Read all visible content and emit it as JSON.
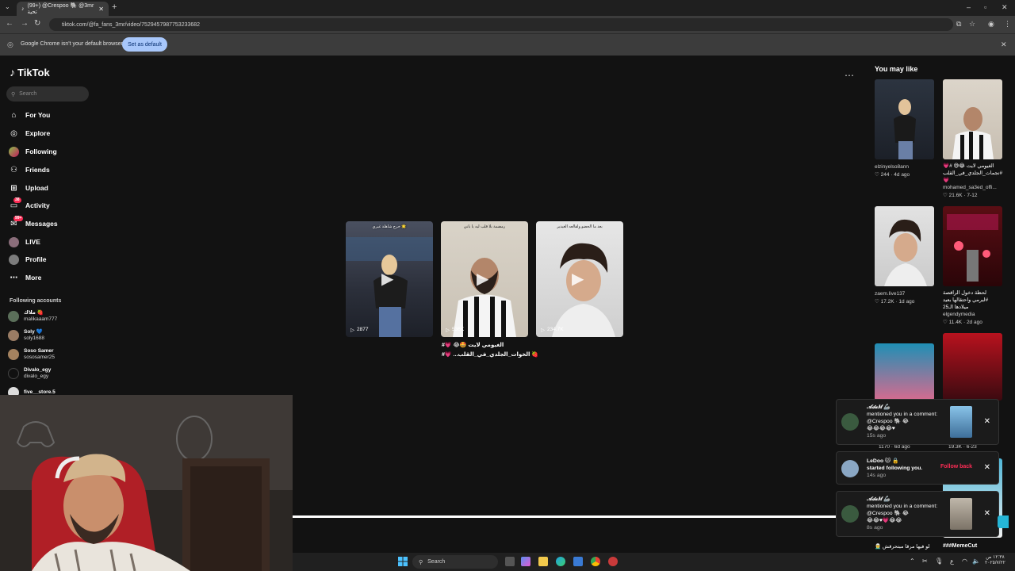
{
  "browser": {
    "tab_title": "(99+) @Crespoo 🐘 @3mr تحية",
    "url": "tiktok.com/@fa_fans_3mr/video/7529457987753233682",
    "infobar_text": "Google Chrome isn't your default browser",
    "set_default_label": "Set as default"
  },
  "sidebar": {
    "logo": "TikTok",
    "search_placeholder": "Search",
    "items": [
      {
        "label": "For You",
        "icon": "home-icon"
      },
      {
        "label": "Explore",
        "icon": "compass-icon"
      },
      {
        "label": "Following",
        "icon": "following-icon"
      },
      {
        "label": "Friends",
        "icon": "friends-icon"
      },
      {
        "label": "Upload",
        "icon": "upload-icon"
      },
      {
        "label": "Activity",
        "icon": "activity-icon",
        "badge": "38"
      },
      {
        "label": "Messages",
        "icon": "messages-icon",
        "badge": "99+"
      },
      {
        "label": "LIVE",
        "icon": "live-icon"
      },
      {
        "label": "Profile",
        "icon": "profile-icon"
      },
      {
        "label": "More",
        "icon": "more-icon"
      }
    ],
    "following_header": "Following accounts",
    "accounts": [
      {
        "name": "ملاك 🍓",
        "handle": "malikaaam777"
      },
      {
        "name": "Soly 💙",
        "handle": "soly1688"
      },
      {
        "name": "Soso Samer",
        "handle": "sososamer25"
      },
      {
        "name": "Divalo_egy",
        "handle": "divalo_egy"
      },
      {
        "name": "five__store.5",
        "handle": ""
      }
    ]
  },
  "videos": [
    {
      "views": "2877",
      "caption_overlay": "خرج شاهلة غيري 🌟"
    },
    {
      "views": "536K",
      "caption_overlay": "رمضمة بلا قلب ليه يا باني",
      "caption": "#💗 😂🤩 الغيومي لايت",
      "caption2": "#💗 ...الخوات_الجلدي_في_القلب 🍓"
    },
    {
      "views": "234.7K",
      "caption_overlay": "بعد ما الحضو ولقالعه الغيدير"
    }
  ],
  "you_may_like": {
    "title": "You may like",
    "cards": [
      {
        "title": "",
        "user": "elzinyelso8ann",
        "likes": "244",
        "age": "4d ago"
      },
      {
        "title": "الغيومي لايت 😂😅 #💗 #نجمات_الجلدي_في_القلب 💗",
        "user": "mohamed_sa3ed_offi...",
        "likes": "21.6K",
        "age": "7-12"
      },
      {
        "title": "",
        "user": "zaem.live137",
        "likes": "17.2K",
        "age": "1d ago"
      },
      {
        "title": "لحظة دخول الراقصة #لبرمي واحتقالها بعيد ميلادها الـ25",
        "user": "elgendymedia",
        "likes": "11.4K",
        "age": "2d ago"
      }
    ],
    "bottom_titles": [
      "🧝‍♂️ لو فيها مرقا مبتحرقش",
      "###MemeCut"
    ],
    "partial_stats": [
      "1170",
      "6d ago",
      "19.3K",
      "6-23"
    ]
  },
  "notifications": [
    {
      "name": "𝒜𝒹𝒶𝑀 🦾",
      "text": "mentioned you in a comment: @Crespoo 🐘 😂",
      "emoji": "😂😂😂😂♥",
      "time": "15s ago"
    },
    {
      "name": "LeDoo 🐱 🔒",
      "text": "started following you.",
      "time": "14s ago",
      "action": "Follow back"
    },
    {
      "name": "𝒜𝒹𝒶𝑀 🦾",
      "text": "mentioned you in a comment: @Crespoo 🐘 😂",
      "emoji": "😂😂♥💗😂😂",
      "time": "8s ago"
    }
  ],
  "taskbar": {
    "search_label": "Search",
    "clock_time": "١٢:٣٨ ص",
    "clock_date": "٢٠٢٥/٧/٢٢",
    "lang": "ع"
  }
}
